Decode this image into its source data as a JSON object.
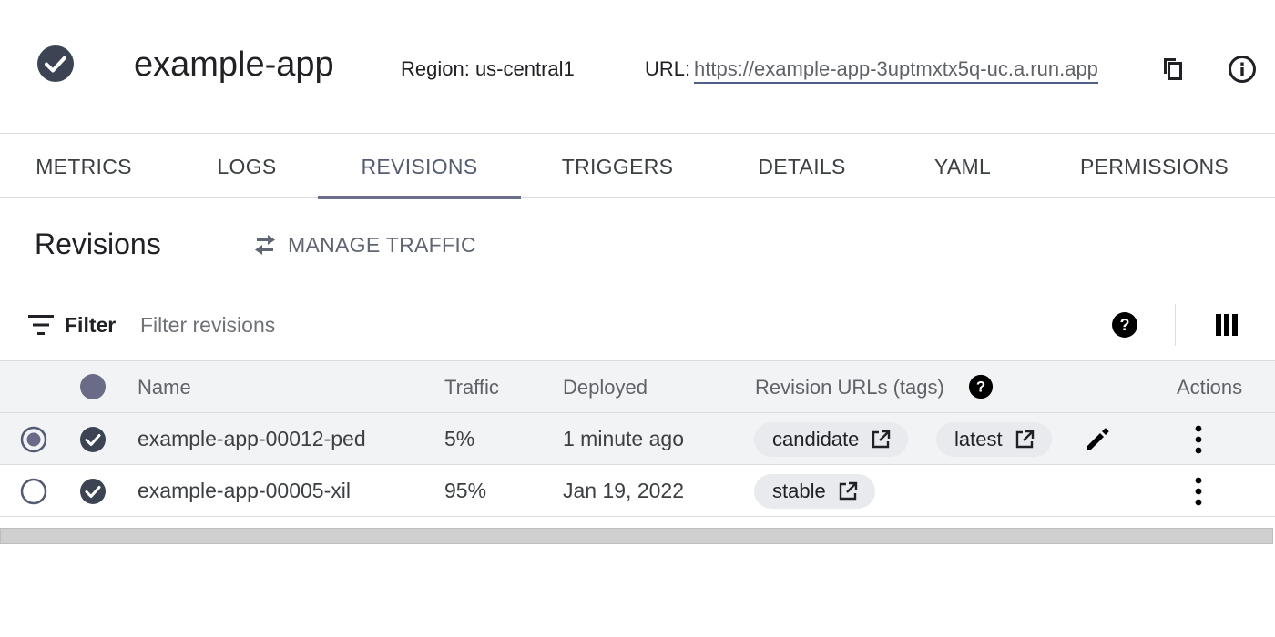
{
  "header": {
    "service_name": "example-app",
    "region_text": "Region: us-central1",
    "url_label": "URL:",
    "url_value": "https://example-app-3uptmxtx5q-uc.a.run.app",
    "status_icon": "check-circle-icon",
    "copy_icon": "copy-icon",
    "info_icon": "info-icon"
  },
  "tabs": [
    {
      "label": "METRICS"
    },
    {
      "label": "LOGS"
    },
    {
      "label": "REVISIONS",
      "active": true
    },
    {
      "label": "TRIGGERS"
    },
    {
      "label": "DETAILS"
    },
    {
      "label": "YAML"
    },
    {
      "label": "PERMISSIONS"
    }
  ],
  "revisions": {
    "title": "Revisions",
    "manage_traffic_label": "MANAGE TRAFFIC",
    "manage_traffic_icon": "swap-horiz-icon"
  },
  "filter": {
    "label": "Filter",
    "placeholder": "Filter revisions",
    "icon": "filter-list-icon",
    "help_icon": "help-icon",
    "columns_icon": "view-column-icon"
  },
  "table": {
    "columns": {
      "name": "Name",
      "traffic": "Traffic",
      "deployed": "Deployed",
      "urls": "Revision URLs (tags)",
      "actions": "Actions"
    },
    "rows": [
      {
        "selected": true,
        "name": "example-app-00012-ped",
        "traffic": "5%",
        "deployed": "1 minute ago",
        "tags": [
          "candidate",
          "latest"
        ]
      },
      {
        "selected": false,
        "name": "example-app-00005-xil",
        "traffic": "95%",
        "deployed": "Jan 19, 2022",
        "tags": [
          "stable"
        ]
      }
    ]
  },
  "colors": {
    "accent": "#545b75",
    "check_dark": "#3c4454",
    "chip_bg": "#e8eaed",
    "header_row_bg": "#f1f3f4"
  }
}
